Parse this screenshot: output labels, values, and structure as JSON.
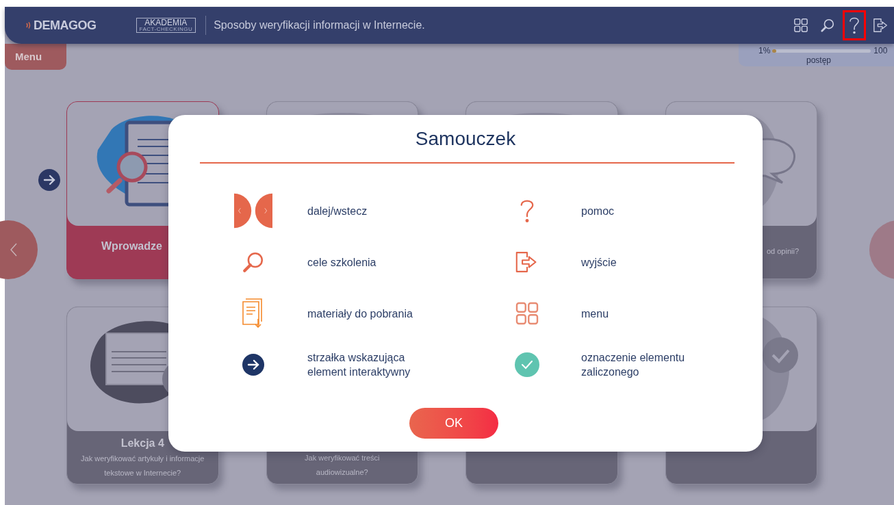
{
  "header": {
    "logo": "DEMAGOG",
    "badge_title": "AKADEMIA",
    "badge_subtitle": "FACT-CHECKINGU",
    "title": "Sposoby weryfikacji informacji w Internecie.",
    "icons": [
      {
        "kind": "grid",
        "highlighted": false
      },
      {
        "kind": "search",
        "highlighted": false
      },
      {
        "kind": "help",
        "highlighted": true
      },
      {
        "kind": "exit",
        "highlighted": false
      }
    ]
  },
  "menu_tab": "Menu",
  "progress": {
    "start": "1%",
    "level": 0.04,
    "end": "100",
    "caption": "postęp"
  },
  "cards": [
    {
      "kind": "clipboard",
      "selected": true,
      "title": "Wprowadze"
    },
    {
      "kind": "blank",
      "selected": false
    },
    {
      "kind": "blank",
      "selected": false
    },
    {
      "kind": "speech",
      "selected": false,
      "subtitle": "od opinii?"
    },
    {
      "kind": "browser",
      "selected": false,
      "title": "Lekcja 4",
      "subtitle": "Jak weryfikować artykuły i informacje tekstowe w Internecie?"
    },
    {
      "kind": "blank",
      "selected": false,
      "subtitle": "Jak weryfikować treści audiowizualne?"
    },
    {
      "kind": "blank",
      "selected": false
    },
    {
      "kind": "person",
      "selected": false
    }
  ],
  "modal": {
    "title": "Samouczek",
    "items": [
      {
        "kind": "prev-next",
        "label": "dalej/wstecz"
      },
      {
        "kind": "help",
        "label": "pomoc"
      },
      {
        "kind": "search",
        "label": "cele szkolenia"
      },
      {
        "kind": "exit",
        "label": "wyjście"
      },
      {
        "kind": "document",
        "label": "materiały do pobrania"
      },
      {
        "kind": "grid",
        "label": "menu"
      },
      {
        "kind": "arrow",
        "label": "strzałka wskazująca element interaktywny"
      },
      {
        "kind": "check",
        "label": "oznaczenie elementu zaliczonego"
      }
    ],
    "button": "OK"
  }
}
